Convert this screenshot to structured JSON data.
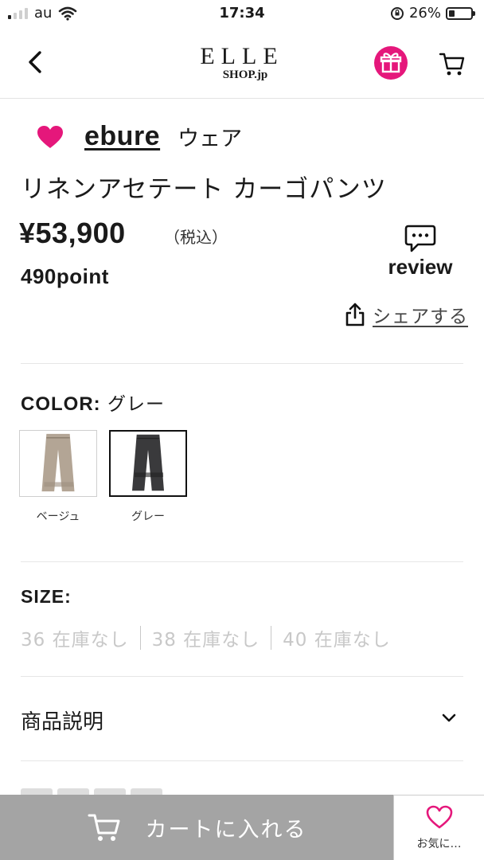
{
  "status_bar": {
    "carrier": "au",
    "time": "17:34",
    "battery": "26%",
    "battery_level": 0.26
  },
  "header": {
    "logo_top": "ELLE",
    "logo_bottom": "SHOP.jp",
    "gift_color": "#e5177b"
  },
  "product": {
    "brand": "ebure",
    "category": "ウェア",
    "name": "リネンアセテート カーゴパンツ",
    "price": "¥53,900",
    "tax_note": "（税込）",
    "points": "490point",
    "review_label": "review",
    "share_label": "シェアする",
    "favorite_color": "#e5177b"
  },
  "color": {
    "label": "COLOR:",
    "selected": "グレー",
    "options": [
      {
        "label": "ベージュ",
        "swatch": "#b3a595"
      },
      {
        "label": "グレー",
        "swatch": "#3a3a3c"
      }
    ]
  },
  "size": {
    "label": "SIZE:",
    "options": [
      "36 在庫なし",
      "38 在庫なし",
      "40 在庫なし"
    ]
  },
  "description": {
    "label": "商品説明"
  },
  "bottom_bar": {
    "add_to_cart": "カートに入れる",
    "favorite": "お気に…",
    "add_to_cart_bg": "#a4a4a4"
  }
}
